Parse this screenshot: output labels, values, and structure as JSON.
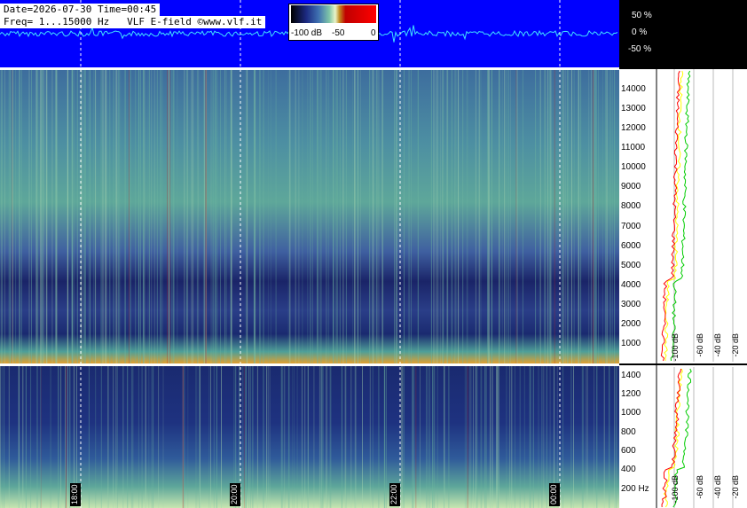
{
  "header": {
    "date_line": "Date=2026-07-30 Time=00:45",
    "freq_line": "Freq= 1...15000 Hz   VLF E-field ©www.vlf.it"
  },
  "legend": {
    "min_label": "-100 dB",
    "mid_label": "-50",
    "max_label": "0"
  },
  "waveform_axis": [
    "50 %",
    "0 %",
    "-50 %"
  ],
  "chart_data": [
    {
      "type": "heatmap",
      "title": "",
      "ylabel": "",
      "ylim": [
        0,
        15000
      ],
      "y_ticks": [
        "1000",
        "2000",
        "3000",
        "4000",
        "5000",
        "6000",
        "7000",
        "8000",
        "9000",
        "10000",
        "11000",
        "12000",
        "13000",
        "14000"
      ],
      "time_labels": [
        "18:00",
        "20:00",
        "22:00",
        "00:00"
      ]
    },
    {
      "type": "heatmap",
      "ylim": [
        0,
        1500
      ],
      "y_ticks": [
        "200 Hz",
        "400",
        "600",
        "800",
        "1000",
        "1200",
        "1400"
      ],
      "time_labels": [
        "18:00",
        "20:00",
        "22:00",
        "00:00"
      ]
    },
    {
      "type": "line",
      "x_ticks": [
        "-100 dB",
        "-60 dB",
        "-40 dB",
        "-20 dB"
      ],
      "colors": {
        "average": "#ffff00",
        "peak": "#00cc00",
        "min": "#ff0000"
      }
    }
  ],
  "colors": {
    "header_bg": "#0000ff",
    "waveform": "#40e0ff",
    "divider": "#ffffff"
  }
}
